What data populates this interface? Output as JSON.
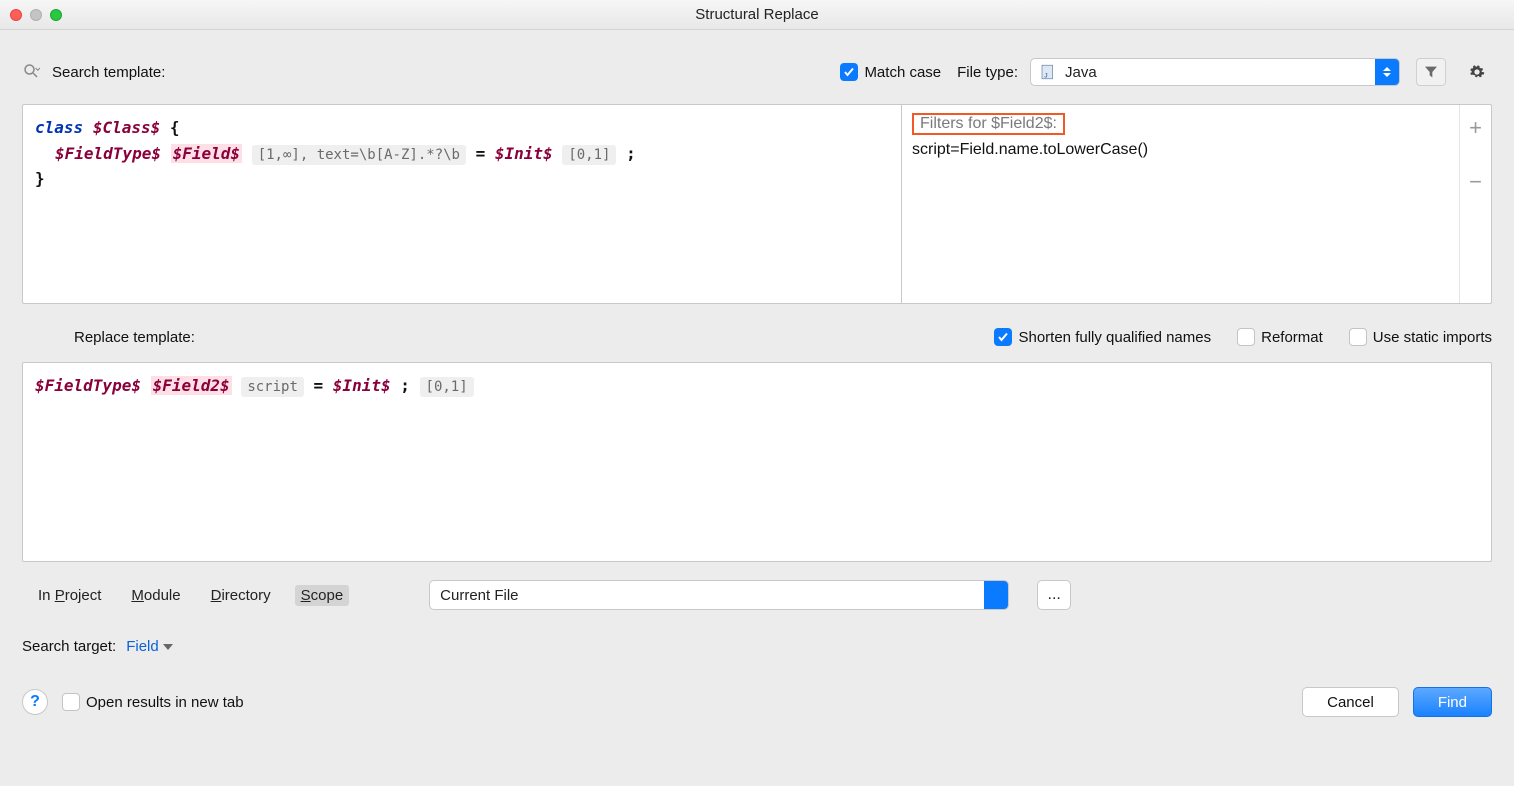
{
  "window": {
    "title": "Structural Replace"
  },
  "row1": {
    "search_label": "Search template:",
    "match_case_label": "Match case",
    "match_case_checked": true,
    "filetype_label": "File type:",
    "filetype_value": "Java"
  },
  "search_editor": {
    "line1_class_kw": "class",
    "line1_class_var": "$Class$",
    "line1_brace": " {",
    "line2_fieldtype_var": "$FieldType$",
    "line2_field_var": "$Field$",
    "line2_hint1": "[1,∞], text=\\b[A-Z].*?\\b",
    "line2_eq": " = ",
    "line2_init_var": "$Init$",
    "line2_hint2": "[0,1]",
    "line2_semi": " ;",
    "line3_brace": "}"
  },
  "filters": {
    "title": "Filters for $Field2$:",
    "body": "script=Field.name.toLowerCase()"
  },
  "row_replace": {
    "label": "Replace template:",
    "shorten_checked": true,
    "shorten_label": "Shorten fully qualified names",
    "reformat_checked": false,
    "reformat_label": "Reformat",
    "static_checked": false,
    "static_label": "Use static imports"
  },
  "replace_editor": {
    "fieldtype_var": "$FieldType$",
    "field2_var": "$Field2$",
    "script_hint": "script",
    "eq": " = ",
    "init_var": "$Init$",
    "semi": ";",
    "hint01": "[0,1]"
  },
  "scope": {
    "tabs": [
      "In Project",
      "Module",
      "Directory",
      "Scope"
    ],
    "mnemonics": [
      "P",
      "M",
      "D",
      "S"
    ],
    "active_index": 3,
    "select_value": "Current File",
    "more": "..."
  },
  "target": {
    "label": "Search target:",
    "value": "Field"
  },
  "bottom": {
    "help": "?",
    "open_results_checked": false,
    "open_results_label": "Open results in new tab",
    "cancel": "Cancel",
    "find": "Find"
  }
}
